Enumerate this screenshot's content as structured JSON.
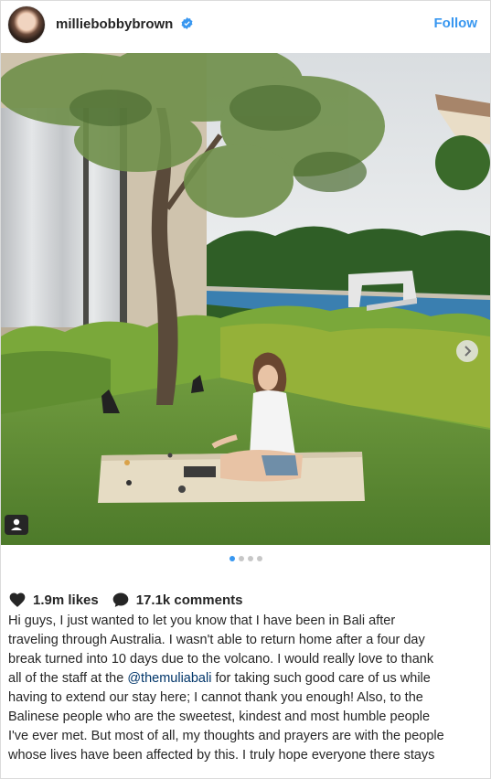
{
  "post": {
    "username": "milliebobbybrown",
    "follow_label": "Follow",
    "icons": {
      "verified": "verified-badge-icon",
      "next": "chevron-right-icon",
      "user_tag": "user-tag-icon",
      "like": "heart-icon",
      "comment": "comment-bubble-icon"
    },
    "colors": {
      "accent": "#3897f0",
      "text": "#262626",
      "mention": "#003569"
    },
    "carousel": {
      "count": 4,
      "active_index": 0
    },
    "likes": "1.9m likes",
    "comments": "17.1k comments",
    "caption": {
      "before_mention": "Hi guys, I just wanted to let you know that I have been in Bali after traveling through Australia. I wasn't able to return home after a four day break turned into 10 days due to the volcano. I would really love to thank all of the staff at the ",
      "mention": "@themuliabali",
      "after_mention": " for taking such good care of us while having to extend our stay here; I cannot thank you enough! Also, to the Balinese people who are the sweetest, kindest and most humble people I've ever met. But most of all, my thoughts and prayers are with the people whose lives have been affected by this. I truly hope everyone there stays"
    }
  }
}
